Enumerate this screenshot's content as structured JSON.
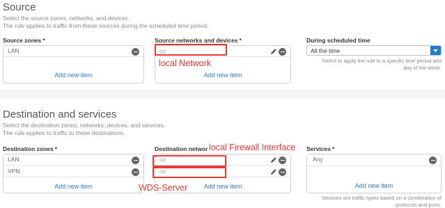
{
  "source": {
    "title": "Source",
    "desc1": "Select the source zones, networks, and devices.",
    "desc2": "The rule applies to traffic from these sources during the scheduled time period.",
    "zones_label": "Source zones",
    "zones": [
      "LAN"
    ],
    "zones_add": "Add new item",
    "networks_label": "Source networks and devices",
    "networks": [
      "co"
    ],
    "networks_add": "Add new item",
    "schedule_label": "During scheduled time",
    "schedule_value": "All the time",
    "schedule_hint1": "Select to apply the rule to a specific time period and",
    "schedule_hint2": "day of the week."
  },
  "destination": {
    "title": "Destination and services",
    "desc1": "Select the destination zones, networks, devices, and services.",
    "desc2": "The rule applies to traffic to these destinations.",
    "zones_label": "Destination zones",
    "zones": [
      "LAN",
      "VPN"
    ],
    "zones_add": "Add new item",
    "networks_label": "Destination networks",
    "networks": [
      "co",
      "co"
    ],
    "networks_add": "Add new item",
    "services_label": "Services",
    "services": [
      "Any"
    ],
    "services_add": "Add new item",
    "services_hint1": "Services are traffic types based on a combination of",
    "services_hint2": "protocols and ports."
  },
  "required_mark": "*",
  "annotations": {
    "local_network": "local Network",
    "local_firewall": "local Firewall Interface",
    "wds_server": "WDS-Server"
  },
  "colors": {
    "accent": "#2a7bd1",
    "annotation": "#e53935",
    "select_caret": "#1f7ac7"
  }
}
